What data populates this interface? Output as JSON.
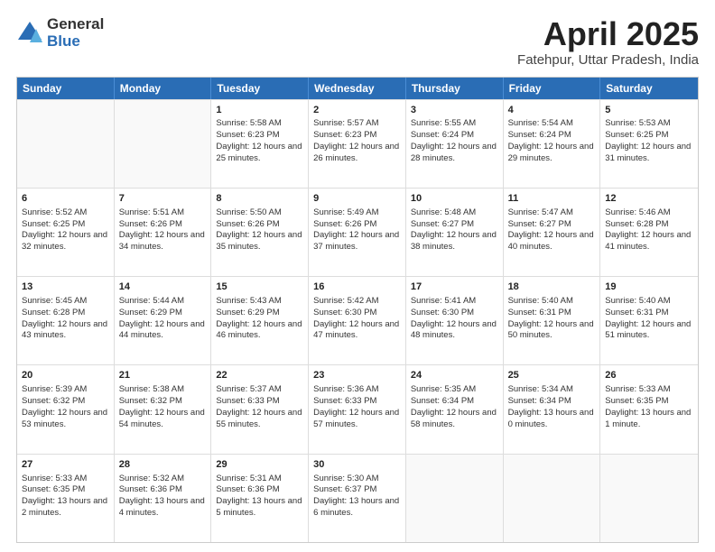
{
  "logo": {
    "general": "General",
    "blue": "Blue"
  },
  "title": {
    "month": "April 2025",
    "location": "Fatehpur, Uttar Pradesh, India"
  },
  "weekdays": [
    "Sunday",
    "Monday",
    "Tuesday",
    "Wednesday",
    "Thursday",
    "Friday",
    "Saturday"
  ],
  "weeks": [
    [
      {
        "day": "",
        "info": "",
        "empty": true
      },
      {
        "day": "",
        "info": "",
        "empty": true
      },
      {
        "day": "1",
        "info": "Sunrise: 5:58 AM\nSunset: 6:23 PM\nDaylight: 12 hours and 25 minutes.",
        "empty": false
      },
      {
        "day": "2",
        "info": "Sunrise: 5:57 AM\nSunset: 6:23 PM\nDaylight: 12 hours and 26 minutes.",
        "empty": false
      },
      {
        "day": "3",
        "info": "Sunrise: 5:55 AM\nSunset: 6:24 PM\nDaylight: 12 hours and 28 minutes.",
        "empty": false
      },
      {
        "day": "4",
        "info": "Sunrise: 5:54 AM\nSunset: 6:24 PM\nDaylight: 12 hours and 29 minutes.",
        "empty": false
      },
      {
        "day": "5",
        "info": "Sunrise: 5:53 AM\nSunset: 6:25 PM\nDaylight: 12 hours and 31 minutes.",
        "empty": false
      }
    ],
    [
      {
        "day": "6",
        "info": "Sunrise: 5:52 AM\nSunset: 6:25 PM\nDaylight: 12 hours and 32 minutes.",
        "empty": false
      },
      {
        "day": "7",
        "info": "Sunrise: 5:51 AM\nSunset: 6:26 PM\nDaylight: 12 hours and 34 minutes.",
        "empty": false
      },
      {
        "day": "8",
        "info": "Sunrise: 5:50 AM\nSunset: 6:26 PM\nDaylight: 12 hours and 35 minutes.",
        "empty": false
      },
      {
        "day": "9",
        "info": "Sunrise: 5:49 AM\nSunset: 6:26 PM\nDaylight: 12 hours and 37 minutes.",
        "empty": false
      },
      {
        "day": "10",
        "info": "Sunrise: 5:48 AM\nSunset: 6:27 PM\nDaylight: 12 hours and 38 minutes.",
        "empty": false
      },
      {
        "day": "11",
        "info": "Sunrise: 5:47 AM\nSunset: 6:27 PM\nDaylight: 12 hours and 40 minutes.",
        "empty": false
      },
      {
        "day": "12",
        "info": "Sunrise: 5:46 AM\nSunset: 6:28 PM\nDaylight: 12 hours and 41 minutes.",
        "empty": false
      }
    ],
    [
      {
        "day": "13",
        "info": "Sunrise: 5:45 AM\nSunset: 6:28 PM\nDaylight: 12 hours and 43 minutes.",
        "empty": false
      },
      {
        "day": "14",
        "info": "Sunrise: 5:44 AM\nSunset: 6:29 PM\nDaylight: 12 hours and 44 minutes.",
        "empty": false
      },
      {
        "day": "15",
        "info": "Sunrise: 5:43 AM\nSunset: 6:29 PM\nDaylight: 12 hours and 46 minutes.",
        "empty": false
      },
      {
        "day": "16",
        "info": "Sunrise: 5:42 AM\nSunset: 6:30 PM\nDaylight: 12 hours and 47 minutes.",
        "empty": false
      },
      {
        "day": "17",
        "info": "Sunrise: 5:41 AM\nSunset: 6:30 PM\nDaylight: 12 hours and 48 minutes.",
        "empty": false
      },
      {
        "day": "18",
        "info": "Sunrise: 5:40 AM\nSunset: 6:31 PM\nDaylight: 12 hours and 50 minutes.",
        "empty": false
      },
      {
        "day": "19",
        "info": "Sunrise: 5:40 AM\nSunset: 6:31 PM\nDaylight: 12 hours and 51 minutes.",
        "empty": false
      }
    ],
    [
      {
        "day": "20",
        "info": "Sunrise: 5:39 AM\nSunset: 6:32 PM\nDaylight: 12 hours and 53 minutes.",
        "empty": false
      },
      {
        "day": "21",
        "info": "Sunrise: 5:38 AM\nSunset: 6:32 PM\nDaylight: 12 hours and 54 minutes.",
        "empty": false
      },
      {
        "day": "22",
        "info": "Sunrise: 5:37 AM\nSunset: 6:33 PM\nDaylight: 12 hours and 55 minutes.",
        "empty": false
      },
      {
        "day": "23",
        "info": "Sunrise: 5:36 AM\nSunset: 6:33 PM\nDaylight: 12 hours and 57 minutes.",
        "empty": false
      },
      {
        "day": "24",
        "info": "Sunrise: 5:35 AM\nSunset: 6:34 PM\nDaylight: 12 hours and 58 minutes.",
        "empty": false
      },
      {
        "day": "25",
        "info": "Sunrise: 5:34 AM\nSunset: 6:34 PM\nDaylight: 13 hours and 0 minutes.",
        "empty": false
      },
      {
        "day": "26",
        "info": "Sunrise: 5:33 AM\nSunset: 6:35 PM\nDaylight: 13 hours and 1 minute.",
        "empty": false
      }
    ],
    [
      {
        "day": "27",
        "info": "Sunrise: 5:33 AM\nSunset: 6:35 PM\nDaylight: 13 hours and 2 minutes.",
        "empty": false
      },
      {
        "day": "28",
        "info": "Sunrise: 5:32 AM\nSunset: 6:36 PM\nDaylight: 13 hours and 4 minutes.",
        "empty": false
      },
      {
        "day": "29",
        "info": "Sunrise: 5:31 AM\nSunset: 6:36 PM\nDaylight: 13 hours and 5 minutes.",
        "empty": false
      },
      {
        "day": "30",
        "info": "Sunrise: 5:30 AM\nSunset: 6:37 PM\nDaylight: 13 hours and 6 minutes.",
        "empty": false
      },
      {
        "day": "",
        "info": "",
        "empty": true
      },
      {
        "day": "",
        "info": "",
        "empty": true
      },
      {
        "day": "",
        "info": "",
        "empty": true
      }
    ]
  ]
}
